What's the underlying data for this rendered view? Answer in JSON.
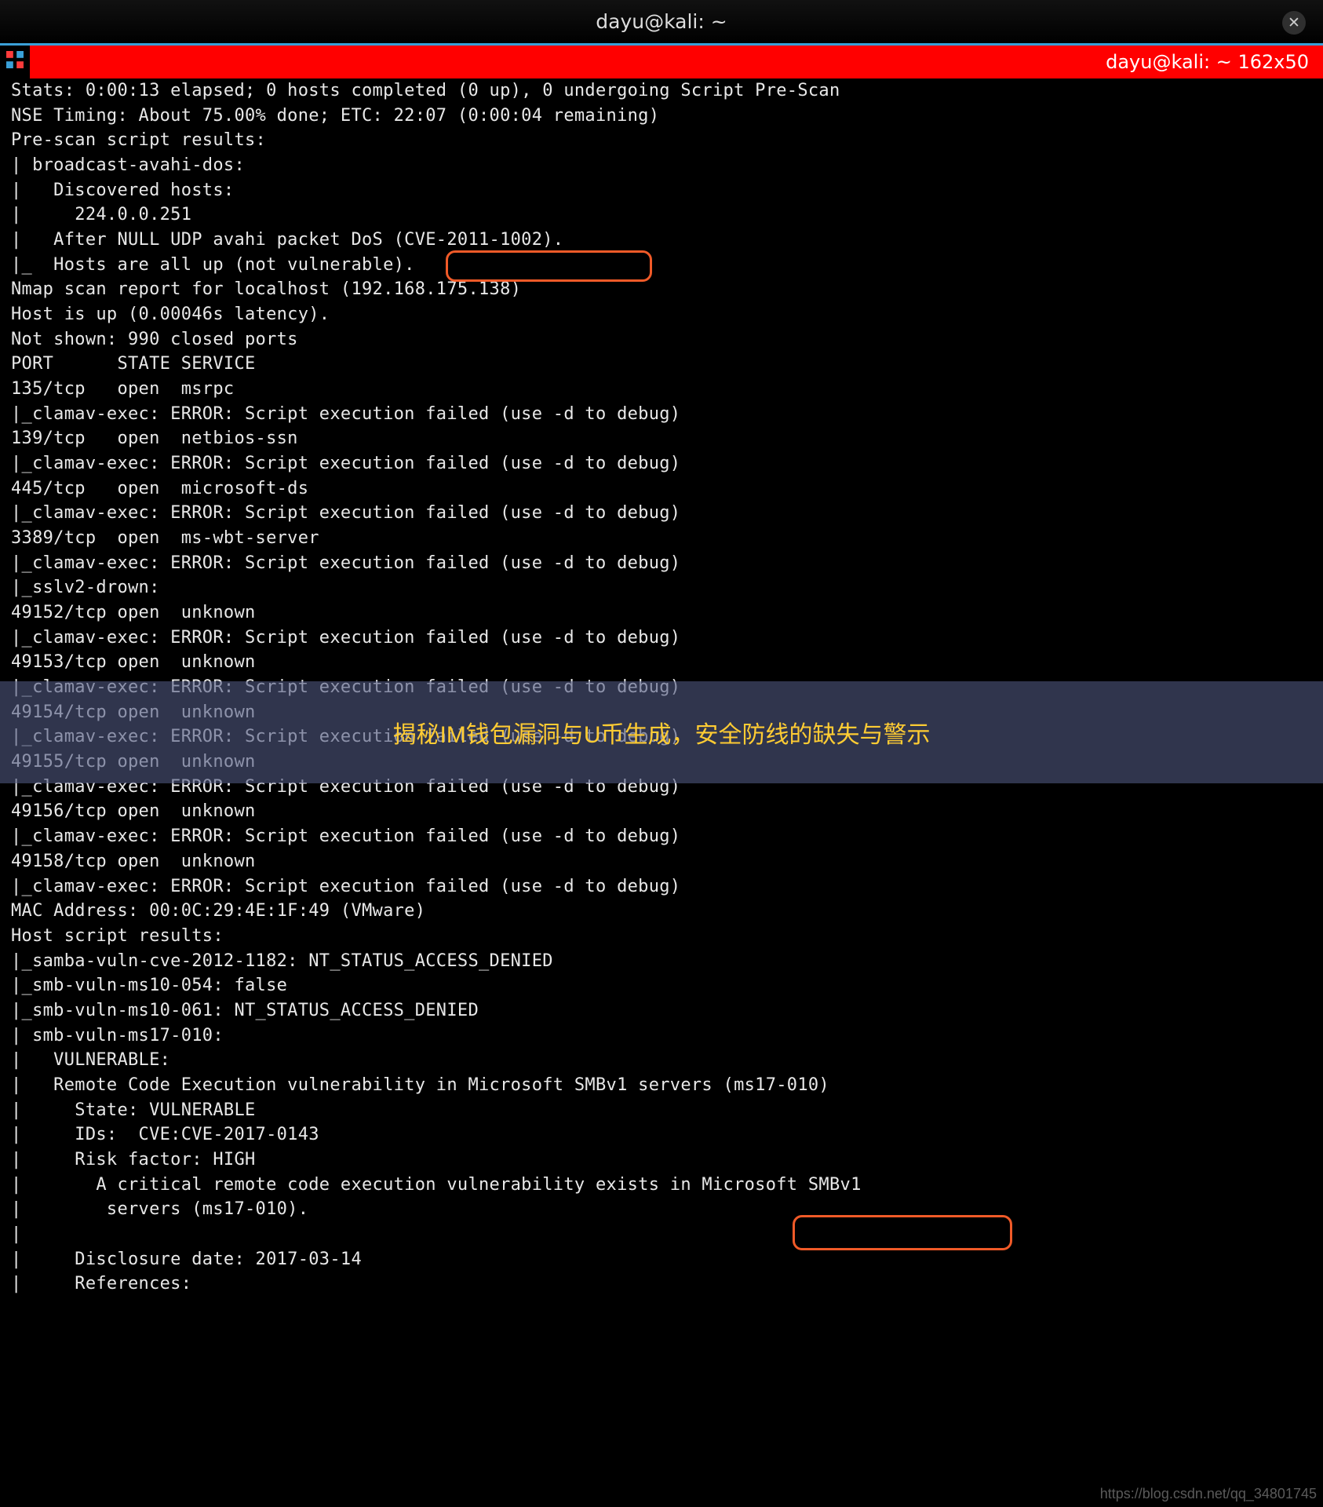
{
  "window": {
    "title": "dayu@kali: ~",
    "close_label": "✕"
  },
  "term_header": {
    "title": "dayu@kali: ~ 162x50"
  },
  "overlay": {
    "text": "揭秘IM钱包漏洞与U币生成，安全防线的缺失与警示"
  },
  "annotations": {
    "cve_2011_1002": "(CVE-2011-1002)",
    "ms17_010": "(ms17-010)"
  },
  "lines": [
    "Stats: 0:00:13 elapsed; 0 hosts completed (0 up), 0 undergoing Script Pre-Scan",
    "NSE Timing: About 75.00% done; ETC: 22:07 (0:00:04 remaining)",
    "Pre-scan script results:",
    "| broadcast-avahi-dos:",
    "|   Discovered hosts:",
    "|     224.0.0.251",
    "|   After NULL UDP avahi packet DoS (CVE-2011-1002).",
    "|_  Hosts are all up (not vulnerable).",
    "Nmap scan report for localhost (192.168.175.138)",
    "Host is up (0.00046s latency).",
    "Not shown: 990 closed ports",
    "PORT      STATE SERVICE",
    "135/tcp   open  msrpc",
    "|_clamav-exec: ERROR: Script execution failed (use -d to debug)",
    "139/tcp   open  netbios-ssn",
    "|_clamav-exec: ERROR: Script execution failed (use -d to debug)",
    "445/tcp   open  microsoft-ds",
    "|_clamav-exec: ERROR: Script execution failed (use -d to debug)",
    "3389/tcp  open  ms-wbt-server",
    "|_clamav-exec: ERROR: Script execution failed (use -d to debug)",
    "|_sslv2-drown:",
    "49152/tcp open  unknown",
    "|_clamav-exec: ERROR: Script execution failed (use -d to debug)",
    "49153/tcp open  unknown",
    "|_clamav-exec: ERROR: Script execution failed (use -d to debug)",
    "49154/tcp open  unknown",
    "|_clamav-exec: ERROR: Script execution failed (use -d to debug)",
    "49155/tcp open  unknown",
    "|_clamav-exec: ERROR: Script execution failed (use -d to debug)",
    "49156/tcp open  unknown",
    "|_clamav-exec: ERROR: Script execution failed (use -d to debug)",
    "49158/tcp open  unknown",
    "|_clamav-exec: ERROR: Script execution failed (use -d to debug)",
    "MAC Address: 00:0C:29:4E:1F:49 (VMware)",
    "",
    "Host script results:",
    "|_samba-vuln-cve-2012-1182: NT_STATUS_ACCESS_DENIED",
    "|_smb-vuln-ms10-054: false",
    "|_smb-vuln-ms10-061: NT_STATUS_ACCESS_DENIED",
    "| smb-vuln-ms17-010:",
    "|   VULNERABLE:",
    "|   Remote Code Execution vulnerability in Microsoft SMBv1 servers (ms17-010)",
    "|     State: VULNERABLE",
    "|     IDs:  CVE:CVE-2017-0143",
    "|     Risk factor: HIGH",
    "|       A critical remote code execution vulnerability exists in Microsoft SMBv1",
    "|        servers (ms17-010).",
    "|",
    "|     Disclosure date: 2017-03-14",
    "|     References:"
  ],
  "watermark": "https://blog.csdn.net/qq_34801745"
}
